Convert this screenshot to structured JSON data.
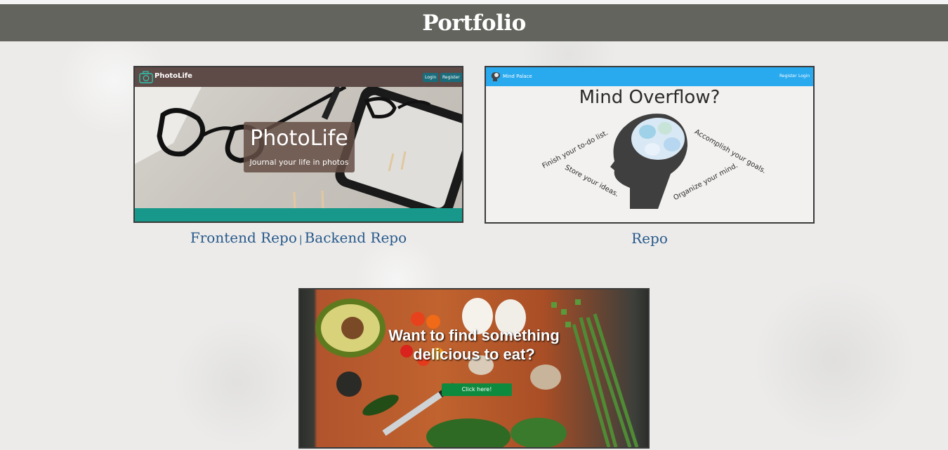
{
  "header": {
    "title": "Portfolio"
  },
  "projects": [
    {
      "preview": {
        "brand": "PhotoLife",
        "nav_buttons": [
          "Login",
          "Register"
        ],
        "hero_title": "PhotoLife",
        "hero_subtitle": "Journal your life in photos"
      },
      "links": [
        "Frontend Repo",
        "Backend Repo"
      ],
      "separator": "|"
    },
    {
      "preview": {
        "brand": "Mind Palace",
        "nav_links": [
          "Register",
          "Login"
        ],
        "hero_title": "Mind Overflow?",
        "phrases": [
          "Finish your to-do list.",
          "Store your ideas.",
          "Accomplish your goals.",
          "Organize your mind."
        ]
      },
      "links": [
        "Repo"
      ]
    },
    {
      "preview": {
        "hero_title_line1": "Want to find something",
        "hero_title_line2": "delicious to eat?",
        "button": "Click here!"
      }
    }
  ],
  "colors": {
    "header_bg": "#64645e",
    "link": "#27598a",
    "photolife_nav": "#5e4a46",
    "photolife_footer": "#17988a",
    "mindpalace_nav": "#29a9ee",
    "food_button": "#0e8a3f"
  },
  "icons": {
    "photolife_logo": "camera-icon",
    "mindpalace_logo": "brain-icon"
  }
}
